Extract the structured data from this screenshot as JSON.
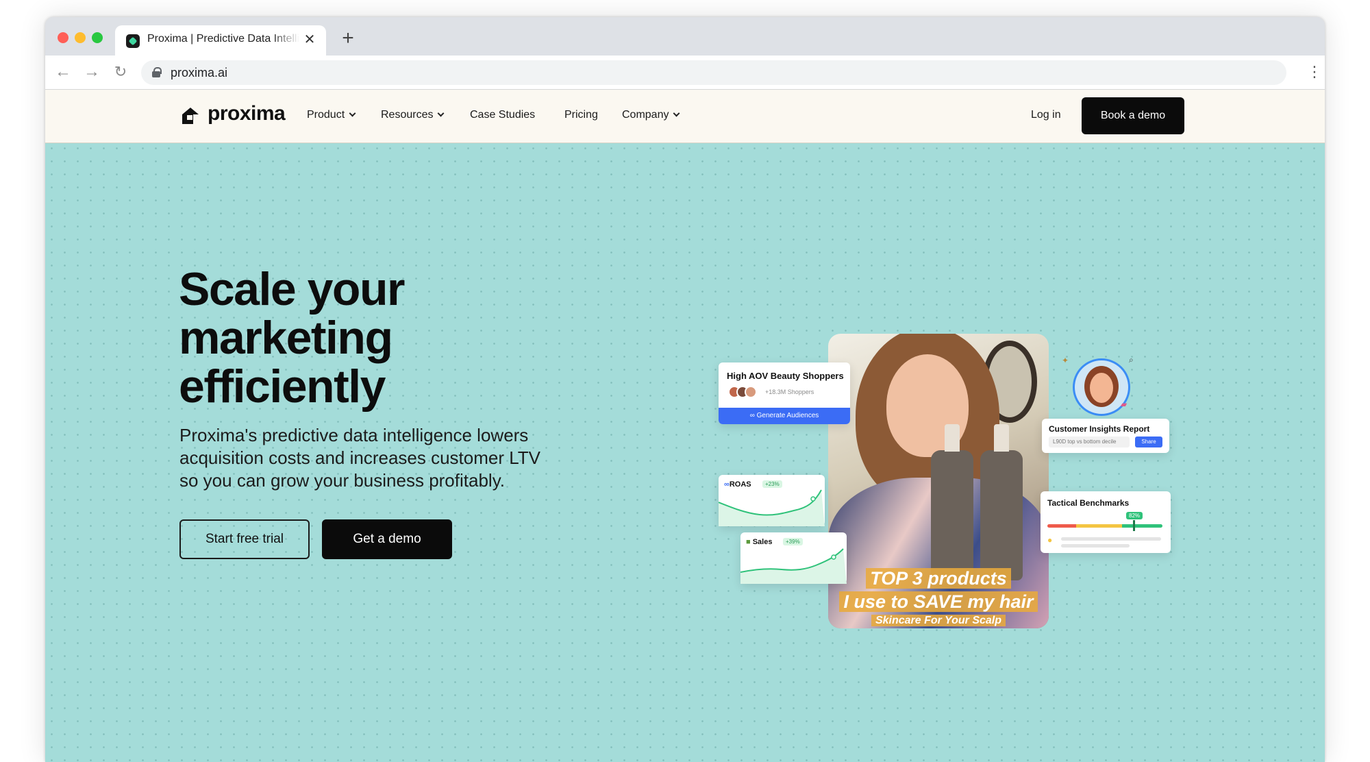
{
  "browser": {
    "tab_title": "Proxima | Predictive Data Intelligence",
    "tab_close": "✕",
    "new_tab": "+",
    "url": "proxima.ai",
    "back": "←",
    "forward": "→",
    "reload": "↻",
    "menu": "⋮"
  },
  "nav": {
    "logo_text": "proxima",
    "items": [
      {
        "label": "Product",
        "has_dropdown": true
      },
      {
        "label": "Resources",
        "has_dropdown": true
      },
      {
        "label": "Case Studies",
        "has_dropdown": false
      },
      {
        "label": "Pricing",
        "has_dropdown": false
      },
      {
        "label": "Company",
        "has_dropdown": true
      }
    ],
    "login": "Log in",
    "cta": "Book a demo"
  },
  "hero": {
    "title_lines": [
      "Scale your",
      "marketing",
      "efficiently"
    ],
    "subtitle_lines": [
      "Proxima's predictive data intelligence lowers",
      "acquisition costs and increases customer LTV",
      "so you can grow your business profitably."
    ],
    "primary_button": "Start free trial",
    "secondary_button": "Get a demo"
  },
  "collage": {
    "audience_card": {
      "title": "High AOV Beauty Shoppers",
      "count": "+18.3M Shoppers",
      "button": "Generate Audiences"
    },
    "roas_card": {
      "label": "ROAS",
      "delta": "+23%"
    },
    "sales_card": {
      "label": "Sales",
      "delta": "+39%"
    },
    "video": {
      "caption_line1": "TOP 3 products",
      "caption_line2": "I use to SAVE my hair",
      "caption_line3": "Skincare For Your Scalp"
    },
    "insights_card": {
      "title": "Customer Insights Report",
      "field": "L90D top vs bottom decile",
      "share": "Share"
    },
    "benchmarks_card": {
      "title": "Tactical Benchmarks",
      "badge": "82%"
    }
  },
  "colors": {
    "hero_bg": "#a4dcd9",
    "nav_bg": "#fbf8f1",
    "primary_dark": "#0b0b0b",
    "accent_blue": "#3b6cf5",
    "accent_green": "#2fc27a"
  }
}
